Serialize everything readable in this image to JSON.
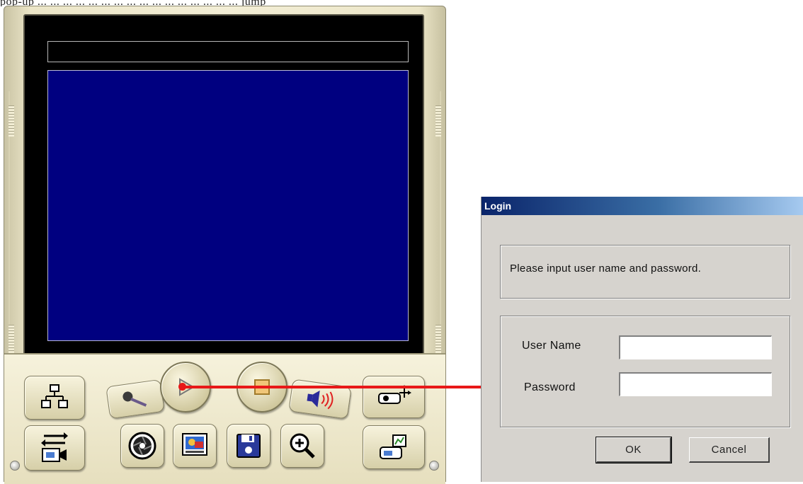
{
  "page_caption": "pop-up ... ... ... ... ... ... ... ... ... ... ... ... ... ... ... ... jump",
  "player": {
    "buttons": [
      {
        "name": "network-button",
        "icon": "network-tree-icon"
      },
      {
        "name": "switch-camera-button",
        "icon": "swap-camera-icon"
      },
      {
        "name": "microphone-button",
        "icon": "microphone-icon"
      },
      {
        "name": "play-button",
        "icon": "play-icon"
      },
      {
        "name": "stop-button",
        "icon": "stop-icon"
      },
      {
        "name": "speaker-button",
        "icon": "speaker-icon"
      },
      {
        "name": "ptz-button",
        "icon": "ptz-camera-icon"
      },
      {
        "name": "snapshot-button",
        "icon": "aperture-icon"
      },
      {
        "name": "display-button",
        "icon": "monitor-icon"
      },
      {
        "name": "save-button",
        "icon": "floppy-disk-icon"
      },
      {
        "name": "zoom-button",
        "icon": "zoom-in-icon"
      },
      {
        "name": "config-button",
        "icon": "device-settings-icon"
      }
    ]
  },
  "login": {
    "title": "Login",
    "message": "Please input  user name and password.",
    "user_label": "User Name",
    "password_label": "Password",
    "user_value": "",
    "password_value": "",
    "ok_label": "OK",
    "cancel_label": "Cancel"
  },
  "colors": {
    "video_background": "#000080",
    "arrow": "#e81818",
    "titlebar_start": "#0a246a",
    "titlebar_end": "#a6caf0"
  }
}
